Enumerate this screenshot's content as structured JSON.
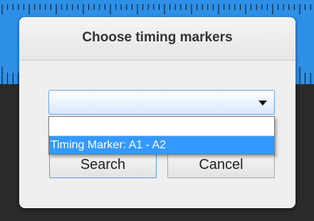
{
  "dialog": {
    "title": "Choose timing markers",
    "combo": {
      "value": "",
      "options": [
        "",
        "Timing Marker: A1 - A2"
      ],
      "selected_option": "Timing Marker: A1 - A2"
    },
    "search_label": "Search",
    "cancel_label": "Cancel"
  },
  "colors": {
    "background_top": "#2e8fe6",
    "background_bottom": "#2a2a2a",
    "selection": "#3399ff"
  }
}
